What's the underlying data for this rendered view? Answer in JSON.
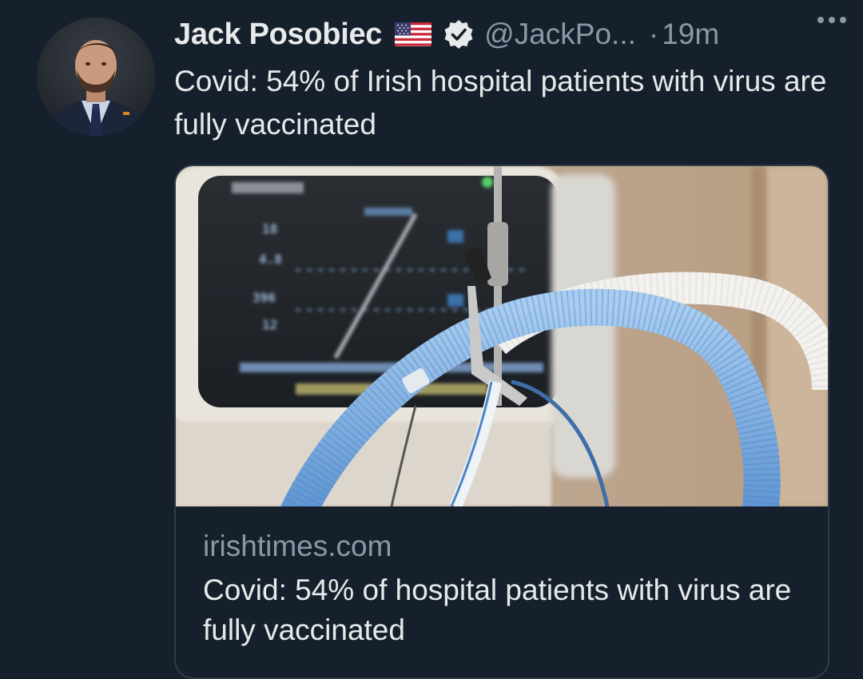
{
  "tweet": {
    "author_name": "Jack Posobiec",
    "handle": "@JackPo...",
    "separator": "·",
    "time": "19m",
    "text": "Covid: 54% of Irish hospital patients with virus are fully vaccinated"
  },
  "card": {
    "domain": "irishtimes.com",
    "title": "Covid: 54% of hospital patients with virus are fully vaccinated",
    "image_monitor_numbers": [
      "18",
      "4.8",
      "396",
      "12"
    ]
  },
  "colors": {
    "background": "#16202c",
    "text_primary": "#e7e9ea",
    "text_secondary": "#8b98a5",
    "card_border": "#2f3b47"
  },
  "icons": {
    "flag": "us-flag-emoji",
    "verified": "verified-badge-icon",
    "more": "more-options-icon"
  }
}
